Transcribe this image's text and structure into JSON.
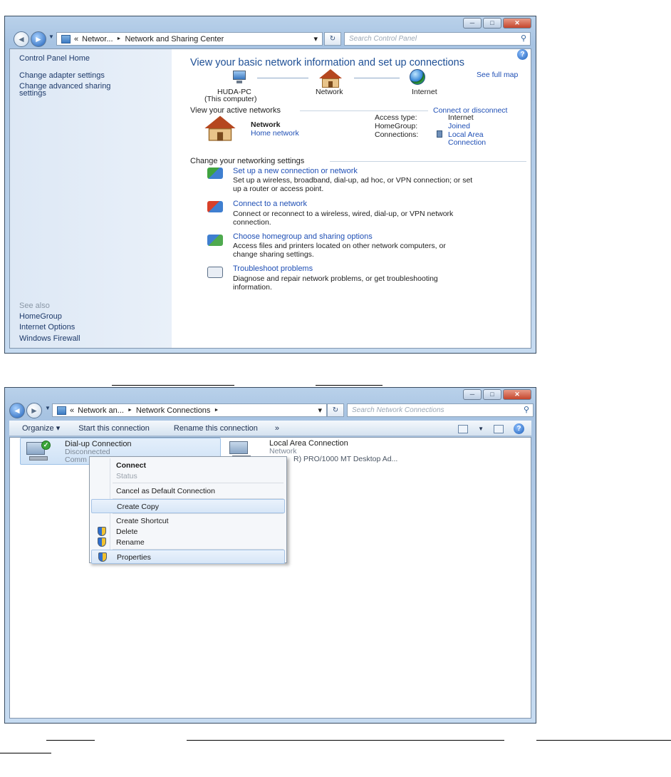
{
  "window1": {
    "caption_buttons": [
      "─",
      "□",
      "✕"
    ],
    "address": {
      "crumb_prefix": "«",
      "crumb1": "Networ...",
      "sep": "►",
      "crumb2": "Network and Sharing Center",
      "dropdown": "▾",
      "refresh": "↻"
    },
    "search_placeholder": "Search Control Panel",
    "left_nav": {
      "home": "Control Panel Home",
      "adapter": "Change adapter settings",
      "advanced_line1": "Change advanced sharing",
      "advanced_line2": "settings",
      "see_also": "See also",
      "homegroup": "HomeGroup",
      "internet_options": "Internet Options",
      "firewall": "Windows Firewall"
    },
    "heading": "View your basic network information and set up connections",
    "see_full_map": "See full map",
    "map": {
      "computer_name": "HUDA-PC",
      "computer_sub": "(This computer)",
      "network": "Network",
      "internet": "Internet"
    },
    "active_networks": {
      "title": "View your active networks",
      "connect_link": "Connect or disconnect",
      "network_name": "Network",
      "network_type": "Home network",
      "access_type_label": "Access type:",
      "access_type_value": "Internet",
      "homegroup_label": "HomeGroup:",
      "homegroup_value": "Joined",
      "connections_label": "Connections:",
      "connections_value_line1": "Local Area",
      "connections_value_line2": "Connection"
    },
    "settings": {
      "title": "Change your networking settings",
      "tasks": [
        {
          "title": "Set up a new connection or network",
          "line1": "Set up a wireless, broadband, dial-up, ad hoc, or VPN connection; or set",
          "line2": "up a router or access point."
        },
        {
          "title": "Connect to a network",
          "line1": "Connect or reconnect to a wireless, wired, dial-up, or VPN network",
          "line2": "connection."
        },
        {
          "title": "Choose homegroup and sharing options",
          "line1": "Access files and printers located on other network computers, or",
          "line2": "change sharing settings."
        },
        {
          "title": "Troubleshoot problems",
          "line1": "Diagnose and repair network problems, or get troubleshooting",
          "line2": "information."
        }
      ]
    },
    "help": "?"
  },
  "window2": {
    "caption_buttons": [
      "─",
      "□",
      "✕"
    ],
    "address": {
      "crumb_prefix": "«",
      "crumb1": "Network an...",
      "sep": "►",
      "crumb2": "Network Connections",
      "sep2": "►",
      "dropdown": "▾",
      "refresh": "↻"
    },
    "search_placeholder": "Search Network Connections",
    "toolbar": {
      "organize": "Organize ▾",
      "start": "Start this connection",
      "rename": "Rename this connection",
      "more": "»",
      "help": "?"
    },
    "connections": [
      {
        "name": "Dial-up Connection",
        "status": "Disconnected",
        "device": "Comm"
      },
      {
        "name": "Local Area Connection",
        "status": "Network",
        "device": "R) PRO/1000 MT Desktop Ad..."
      }
    ],
    "context_menu": [
      "Connect",
      "Status",
      "Cancel as Default Connection",
      "Create Copy",
      "Create Shortcut",
      "Delete",
      "Rename",
      "Properties"
    ]
  }
}
